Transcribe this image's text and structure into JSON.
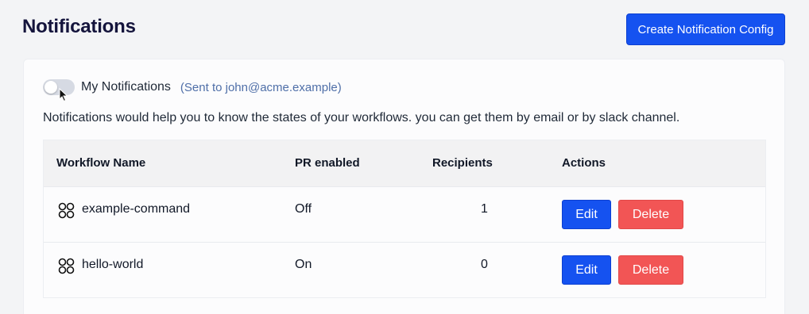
{
  "header": {
    "title": "Notifications",
    "create_button": "Create Notification Config"
  },
  "my_notifications": {
    "label": "My Notifications",
    "sent_to": "(Sent to john@acme.example)",
    "enabled": false
  },
  "description": "Notifications would help you to know the states of your workflows. you can get them by email or by slack channel.",
  "table": {
    "headers": {
      "workflow_name": "Workflow Name",
      "pr_enabled": "PR enabled",
      "recipients": "Recipients",
      "actions": "Actions"
    },
    "rows": [
      {
        "name": "example-command",
        "pr_enabled": "Off",
        "recipients": "1",
        "edit": "Edit",
        "delete": "Delete"
      },
      {
        "name": "hello-world",
        "pr_enabled": "On",
        "recipients": "0",
        "edit": "Edit",
        "delete": "Delete"
      }
    ]
  },
  "icons": {
    "workflow": "workflow-icon",
    "cursor": "mouse-pointer-icon"
  },
  "colors": {
    "primary": "#1552f0",
    "danger": "#f25555",
    "title": "#14143c",
    "link": "#4f6fa8"
  }
}
